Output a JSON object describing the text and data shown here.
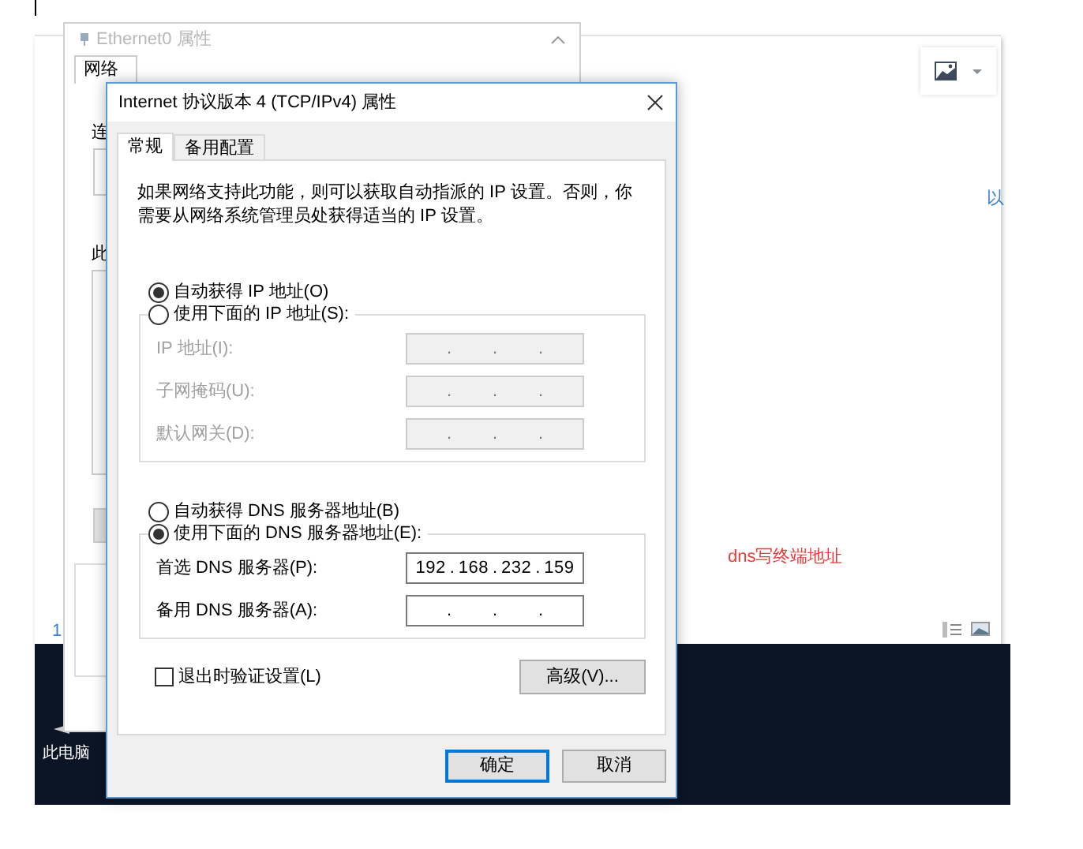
{
  "background_window": {
    "title": "Ethernet0 属性",
    "tab": "网络",
    "fragments": [
      "连",
      "此"
    ]
  },
  "editor": {
    "annotation": "dns写终端地址",
    "edge_text": "以",
    "side_number": "1"
  },
  "desktop_icon": {
    "label": "此电脑"
  },
  "dialog": {
    "title": "Internet 协议版本 4 (TCP/IPv4) 属性",
    "tabs": [
      {
        "label": "常规",
        "selected": true
      },
      {
        "label": "备用配置",
        "selected": false
      }
    ],
    "description": "如果网络支持此功能，则可以获取自动指派的 IP 设置。否则，你需要从网络系统管理员处获得适当的 IP 设置。",
    "octet_separator": ".",
    "ip_section": {
      "options": [
        {
          "label": "自动获得 IP 地址(O)",
          "selected": true
        },
        {
          "label": "使用下面的 IP 地址(S):",
          "selected": false
        }
      ],
      "fields": [
        {
          "label": "IP 地址(I):",
          "disabled": true
        },
        {
          "label": "子网掩码(U):",
          "disabled": true
        },
        {
          "label": "默认网关(D):",
          "disabled": true
        }
      ]
    },
    "dns_section": {
      "options": [
        {
          "label": "自动获得 DNS 服务器地址(B)",
          "selected": false
        },
        {
          "label": "使用下面的 DNS 服务器地址(E):",
          "selected": true
        }
      ],
      "fields": [
        {
          "label": "首选 DNS 服务器(P):",
          "disabled": false,
          "octets": [
            "192",
            "168",
            "232",
            "159"
          ]
        },
        {
          "label": "备用 DNS 服务器(A):",
          "disabled": false
        }
      ]
    },
    "validate_checkbox": {
      "label": "退出时验证设置(L)",
      "checked": false
    },
    "advanced_button": "高级(V)...",
    "buttons": [
      {
        "label": "确定",
        "default": true
      },
      {
        "label": "取消",
        "default": false
      }
    ]
  }
}
